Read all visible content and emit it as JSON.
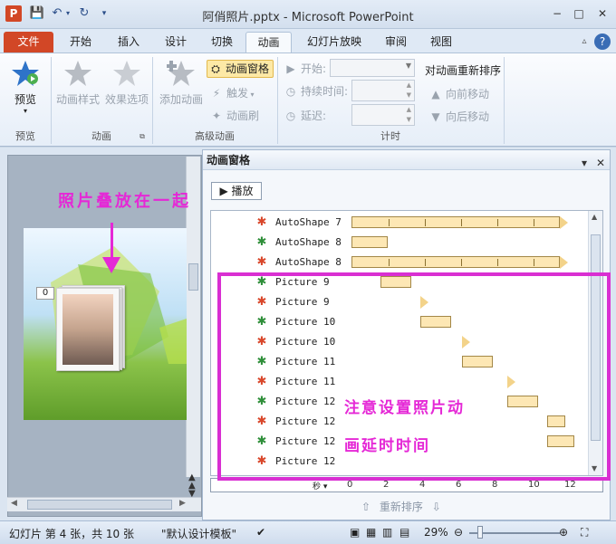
{
  "window": {
    "title": "阿俏照片.pptx - Microsoft PowerPoint",
    "app_icon": "P",
    "minimize": "−",
    "maximize": "□",
    "close": "✕"
  },
  "tabs": [
    "文件",
    "开始",
    "插入",
    "设计",
    "切换",
    "动画",
    "幻灯片放映",
    "审阅",
    "视图"
  ],
  "active_tab": "动画",
  "ribbon": {
    "preview": {
      "button": "预览",
      "group": "预览"
    },
    "animation": {
      "style": "动画样式",
      "effects": "效果选项",
      "group": "动画"
    },
    "advanced": {
      "add": "添加动画",
      "pane_button": "动画窗格",
      "trigger": "触发",
      "painter": "动画刷",
      "group": "高级动画"
    },
    "timing": {
      "start": "开始:",
      "duration": "持续时间:",
      "delay": "延迟:",
      "reorder_title": "对动画重新排序",
      "move_earlier": "向前移动",
      "move_later": "向后移动",
      "group": "计时"
    }
  },
  "slide_note": "照片叠放在一起",
  "slide_badge": "0",
  "pane": {
    "title": "动画窗格",
    "play": "播放",
    "reorder": "重新排序",
    "rows": [
      {
        "label": "AutoShape 7",
        "kind": "exit",
        "start": 0,
        "end": 11.5,
        "tail": true
      },
      {
        "label": "AutoShape 8",
        "kind": "emphasis",
        "start": 0,
        "end": 2,
        "tail": false
      },
      {
        "label": "AutoShape 8",
        "kind": "exit",
        "start": 0,
        "end": 11.5,
        "tail": true
      },
      {
        "label": "Picture 9",
        "kind": "entrance",
        "start": 1.6,
        "end": 3.3,
        "tail": false
      },
      {
        "label": "Picture 9",
        "kind": "exit",
        "start": 3.8,
        "end": 3.8,
        "tail": true
      },
      {
        "label": "Picture 10",
        "kind": "entrance",
        "start": 3.8,
        "end": 5.5,
        "tail": false
      },
      {
        "label": "Picture 10",
        "kind": "exit",
        "start": 6.1,
        "end": 6.1,
        "tail": true
      },
      {
        "label": "Picture 11",
        "kind": "entrance",
        "start": 6.1,
        "end": 7.8,
        "tail": false
      },
      {
        "label": "Picture 11",
        "kind": "exit",
        "start": 8.6,
        "end": 8.6,
        "tail": true
      },
      {
        "label": "Picture 12",
        "kind": "entrance",
        "start": 8.6,
        "end": 10.3,
        "tail": false
      },
      {
        "label": "Picture 12",
        "kind": "exit",
        "start": 10.8,
        "end": 11.8,
        "tail": false
      },
      {
        "label": "Picture 12",
        "kind": "entrance",
        "start": 10.8,
        "end": 12.3,
        "tail": false
      },
      {
        "label": "Picture 12",
        "kind": "exit",
        "start": 0,
        "end": 0,
        "tail": false
      }
    ],
    "timeline_ticks": [
      "0",
      "2",
      "4",
      "6",
      "8",
      "10",
      "12"
    ],
    "note_line1": "注意设置照片动",
    "note_line2": "画延时时间"
  },
  "status": {
    "slide_info": "幻灯片 第 4 张，共 10 张",
    "theme": "\"默认设计模板\"",
    "zoom": "29%"
  },
  "colors": {
    "accent": "#d24726",
    "annotation": "#e528d6",
    "bar_fill": "#fde7b4"
  }
}
